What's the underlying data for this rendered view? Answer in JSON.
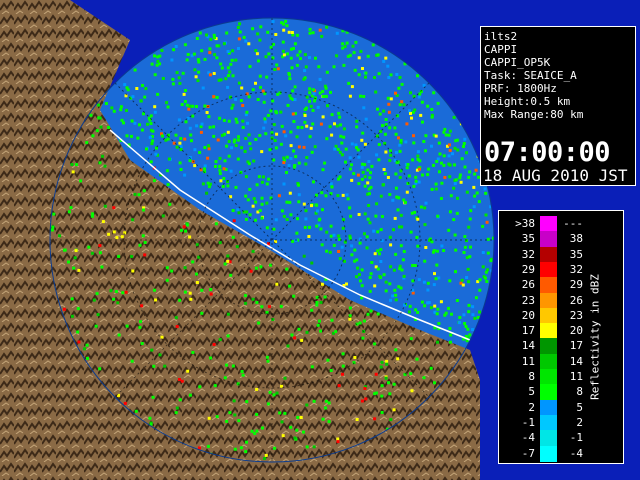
{
  "info": {
    "lines": [
      "ilts2",
      "CAPPI",
      "CAPPI_OP5K",
      "Task: SEAICE_A",
      "PRF: 1800Hz",
      "Height:0.5 km",
      "Max Range:80 km"
    ],
    "time": "07:00:00",
    "date": "18 AUG 2010 JST"
  },
  "legend": {
    "title": "Reflectivity in dBZ",
    "rows": [
      {
        "lo": ">38",
        "hi": "---",
        "color": "#ff00ff"
      },
      {
        "lo": "35",
        "hi": "38",
        "color": "#c800c8"
      },
      {
        "lo": "32",
        "hi": "35",
        "color": "#b40000"
      },
      {
        "lo": "29",
        "hi": "32",
        "color": "#ff0000"
      },
      {
        "lo": "26",
        "hi": "29",
        "color": "#ff5a00"
      },
      {
        "lo": "23",
        "hi": "26",
        "color": "#ff9600"
      },
      {
        "lo": "20",
        "hi": "23",
        "color": "#ffc800"
      },
      {
        "lo": "17",
        "hi": "20",
        "color": "#ffff00"
      },
      {
        "lo": "14",
        "hi": "17",
        "color": "#009600"
      },
      {
        "lo": "11",
        "hi": "14",
        "color": "#00c800"
      },
      {
        "lo": "8",
        "hi": "11",
        "color": "#00e600"
      },
      {
        "lo": "5",
        "hi": "8",
        "color": "#00ff00"
      },
      {
        "lo": "2",
        "hi": "5",
        "color": "#0096ff"
      },
      {
        "lo": "-1",
        "hi": "2",
        "color": "#00c8ff"
      },
      {
        "lo": "-4",
        "hi": "-1",
        "color": "#00e6e6"
      },
      {
        "lo": "-7",
        "hi": "-4",
        "color": "#00ffff"
      }
    ]
  },
  "colors": {
    "sea": "#1a6bd8",
    "outside": "#0a1fb8",
    "land": "#8a6a45",
    "grid": "#2c4a9a"
  }
}
